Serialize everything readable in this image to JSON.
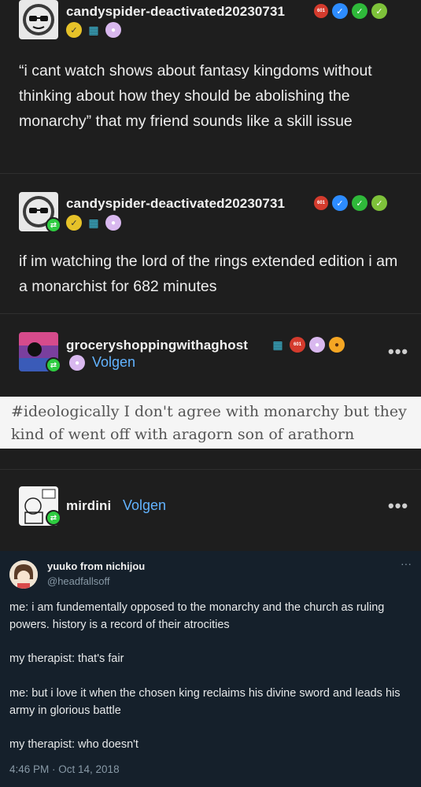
{
  "posts": [
    {
      "username": "candyspider-deactivated20230731",
      "text": "“i cant watch shows about fantasy kingdoms without thinking about how they should be abolishing the monarchy” that my friend sounds like a skill issue"
    },
    {
      "username": "candyspider-deactivated20230731",
      "text": "if im watching the lord of the rings extended edition i am a monarchist for 682 minutes"
    },
    {
      "username": "groceryshoppingwithaghost",
      "follow_label": "Volgen",
      "quote_image_text": "#ideologically I don't agree with monarchy but they kind of went off with aragorn son of arathorn"
    },
    {
      "username": "mirdini",
      "follow_label": "Volgen"
    }
  ],
  "tweet": {
    "name": "yuuko from nichijou",
    "handle": "@headfallsoff",
    "lines": [
      "me: i am fundementally opposed to the monarchy and the church as ruling powers. history is a record of their atrocities",
      "my therapist: that's fair",
      "me: but i love it when the chosen king reclaims his divine sword and leads his army in glorious battle",
      "my therapist: who doesn't"
    ],
    "timestamp": "4:46 PM · Oct 14, 2018"
  },
  "badge_labels": {
    "count": "601"
  },
  "icons": {
    "more": "more-options-icon",
    "reblog": "reblog-icon",
    "verified": "verified-checkmark-icon",
    "paw": "paw-badge-icon"
  },
  "colors": {
    "background": "#1e1e1e",
    "link_blue": "#62b3ff",
    "green_badge": "#2ecc40",
    "tweet_bg": "#15202b"
  }
}
